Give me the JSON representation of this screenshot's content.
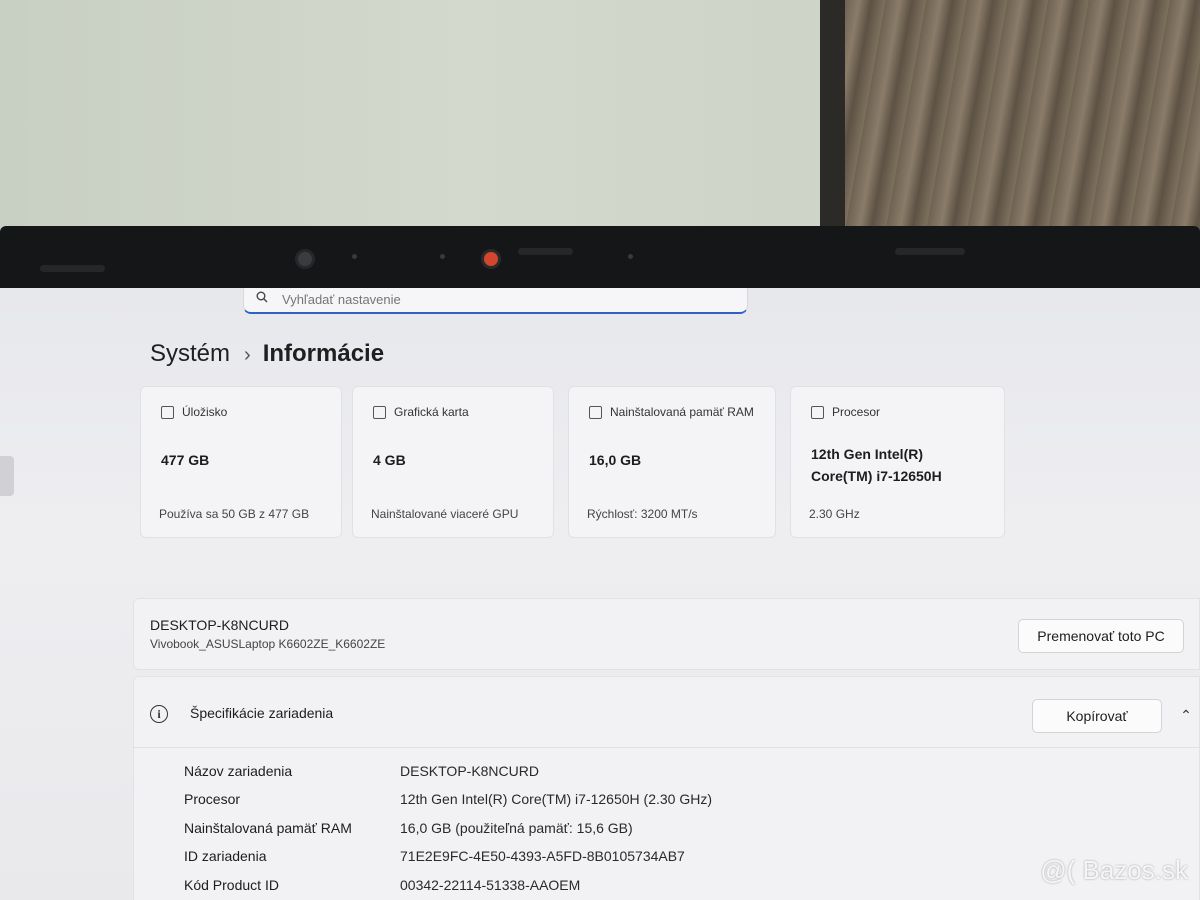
{
  "search": {
    "placeholder": "Vyhľadať nastavenie"
  },
  "breadcrumb": {
    "parent": "Systém",
    "separator": "›",
    "current": "Informácie"
  },
  "cards": [
    {
      "title": "Úložisko",
      "value": "477 GB",
      "sub": "Používa sa 50 GB z 477 GB",
      "icon": "storage-icon"
    },
    {
      "title": "Grafická karta",
      "value": "4 GB",
      "sub": "Nainštalované viaceré GPU",
      "icon": "gpu-icon"
    },
    {
      "title": "Nainštalovaná pamäť RAM",
      "value": "16,0 GB",
      "sub": "Rýchlosť: 3200 MT/s",
      "icon": "ram-icon"
    },
    {
      "title": "Procesor",
      "value": "12th Gen Intel(R) Core(TM) i7-12650H",
      "sub": "2.30 GHz",
      "icon": "processor-icon"
    }
  ],
  "device": {
    "name": "DESKTOP-K8NCURD",
    "model": "Vivobook_ASUSLaptop K6602ZE_K6602ZE",
    "rename_label": "Premenovať toto PC"
  },
  "specs": {
    "title": "Špecifikácie zariadenia",
    "copy_label": "Kopírovať",
    "rows": [
      {
        "key": "Názov zariadenia",
        "value": "DESKTOP-K8NCURD"
      },
      {
        "key": "Procesor",
        "value": "12th Gen Intel(R) Core(TM) i7-12650H (2.30 GHz)"
      },
      {
        "key": "Nainštalovaná pamäť RAM",
        "value": "16,0 GB (použiteľná pamäť: 15,6 GB)"
      },
      {
        "key": "ID zariadenia",
        "value": "71E2E9FC-4E50-4393-A5FD-8B0105734AB7"
      },
      {
        "key": "Kód Product ID",
        "value": "00342-22114-51338-AAOEM"
      }
    ]
  },
  "watermark": "@( Bazos.sk"
}
